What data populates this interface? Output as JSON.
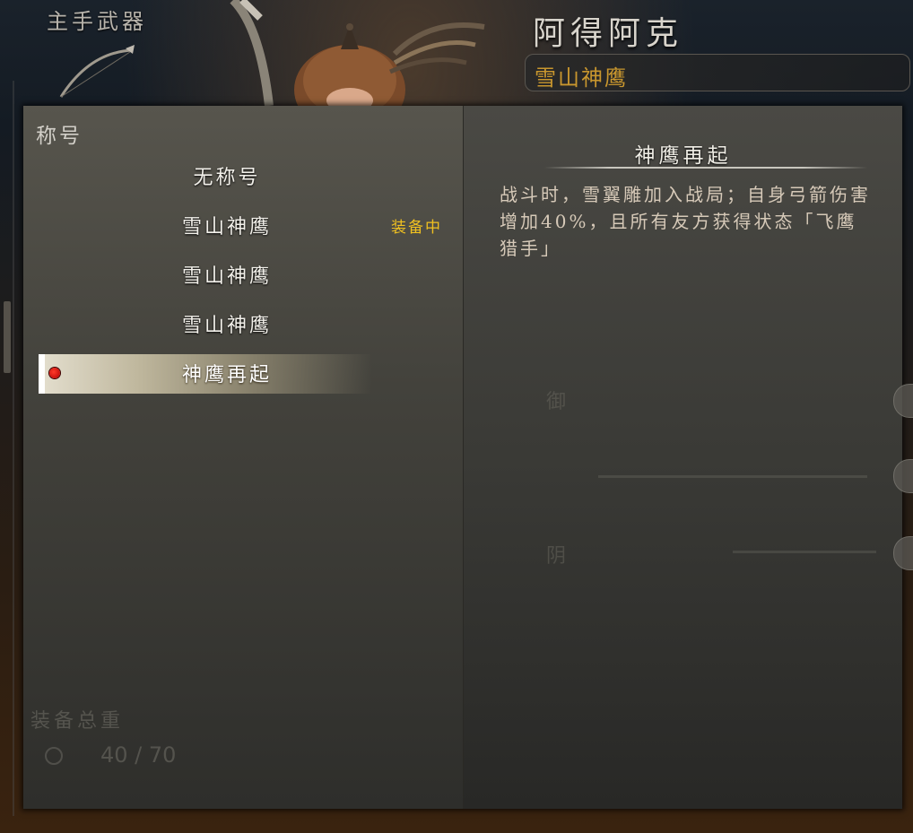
{
  "background": {
    "section_label": "主手武器",
    "character_name": "阿得阿克",
    "character_title": "雪山神鹰"
  },
  "dialog": {
    "header": "称号",
    "titles": [
      {
        "label": "无称号",
        "equipped": "",
        "selected": false
      },
      {
        "label": "雪山神鹰",
        "equipped": "装备中",
        "selected": false
      },
      {
        "label": "雪山神鹰",
        "equipped": "",
        "selected": false
      },
      {
        "label": "雪山神鹰",
        "equipped": "",
        "selected": false
      },
      {
        "label": "神鹰再起",
        "equipped": "",
        "selected": true
      }
    ],
    "ghost": {
      "weight_label": "装备总重",
      "weight_value": "40 / 70",
      "stat_a": "御",
      "stat_b": "阴"
    }
  },
  "detail": {
    "title": "神鹰再起",
    "description": "战斗时，雪翼雕加入战局；自身弓箭伤害增加40%，且所有友方获得状态「飞鹰猎手」"
  },
  "colors": {
    "equipped_text": "#f0c020",
    "character_title": "#c8962e",
    "selection_dot": "#d40000"
  }
}
